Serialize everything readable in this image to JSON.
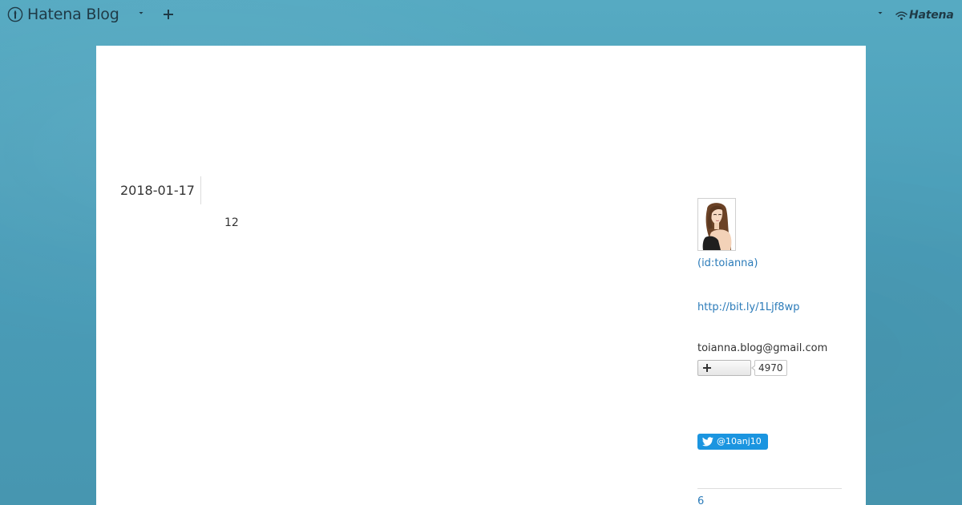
{
  "header": {
    "logo_text": "Hatena Blog",
    "hatena_text": "Hatena"
  },
  "entry": {
    "date": "2018-01-17",
    "body": "12"
  },
  "sidebar": {
    "profile_id": " (id:toianna)",
    "profile_link": "http://bit.ly/1Ljf8wp",
    "email": "toianna.blog@gmail.com",
    "subscriber_count": "4970",
    "twitter_handle": "@10anj10",
    "archive_label": "6"
  },
  "colors": {
    "background": "#4a9db8",
    "link": "#2b7bb9",
    "twitter": "#1b95e0"
  },
  "icons": {
    "logo": "hatena-blog-logo-icon",
    "caret": "caret-down-icon",
    "plus": "plus-icon",
    "hatena": "hatena-wifi-icon",
    "twitter": "twitter-bird-icon"
  }
}
